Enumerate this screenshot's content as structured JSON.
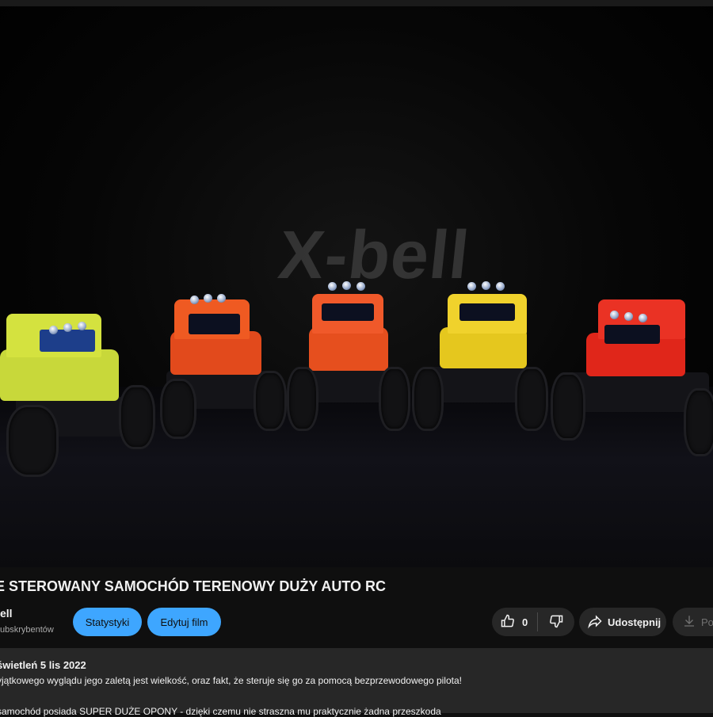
{
  "video": {
    "watermark": "X-bell"
  },
  "info": {
    "title": "E STEROWANY SAMOCHÓD TERENOWY DUŻY AUTO RC",
    "channel_name": "ell",
    "subscribers": "ubskrybentów"
  },
  "actions": {
    "stats_label": "Statystyki",
    "edit_label": "Edytuj film",
    "like_count": "0",
    "share_label": "Udostępnij",
    "download_label": "Po"
  },
  "description": {
    "meta": "świetleń  5 lis 2022",
    "line1": "yjątkowego wyglądu jego zaletą jest wielkość, oraz fakt, że steruje się go za pomocą bezprzewodowego pilota!",
    "line2": "samochód posiada SUPER DUŻE OPONY - dzięki czemu nie straszna mu praktycznie żadna przeszkoda"
  },
  "icons": {
    "like": "thumbs-up-icon",
    "dislike": "thumbs-down-icon",
    "share": "share-arrow-icon",
    "download": "download-icon"
  },
  "colors": {
    "accent_blue": "#3ea6ff",
    "pill_bg": "#272727",
    "page_bg": "#0f0f0f"
  }
}
